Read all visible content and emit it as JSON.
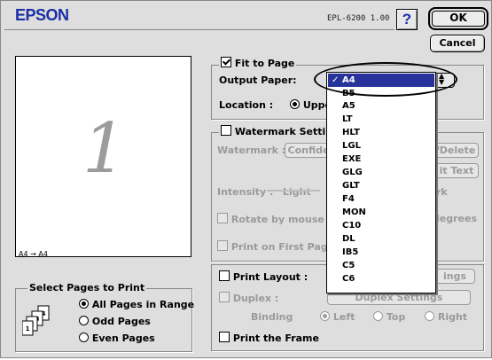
{
  "header": {
    "brand": "EPSON",
    "model_version": "EPL-6200  1.00",
    "help_label": "?",
    "ok_label": "OK",
    "cancel_label": "Cancel"
  },
  "preview": {
    "page_number": "1",
    "size_caption": "A4 → A4"
  },
  "select_pages": {
    "title": "Select Pages to Print",
    "options": [
      "All Pages in Range",
      "Odd Pages",
      "Even Pages"
    ],
    "selected": "All Pages in Range"
  },
  "fit_to_page": {
    "label": "Fit to Page",
    "checked": true,
    "output_paper_label": "Output Paper:",
    "location_label": "Location :",
    "location_value": "Uppe"
  },
  "paper_menu": {
    "selected": "A4",
    "items": [
      "A4",
      "B5",
      "A5",
      "LT",
      "HLT",
      "LGL",
      "EXE",
      "GLG",
      "GLT",
      "F4",
      "MON",
      "C10",
      "DL",
      "IB5",
      "C5",
      "C6"
    ]
  },
  "watermark": {
    "label": "Watermark Settin",
    "checked": false,
    "watermark_label": "Watermark :",
    "watermark_value": "Confide",
    "add_delete_label": "/Delete",
    "edit_text_label": "it Text",
    "intensity_label": "Intensity :",
    "intensity_light": "Light",
    "intensity_dark": "rk",
    "rotate_label": "Rotate by mouse",
    "rotate_unit": "legrees",
    "first_page_label": "Print on First Page"
  },
  "layout": {
    "print_layout_label": "Print Layout :",
    "print_layout_checked": false,
    "layout_settings_label": "ings",
    "duplex_label": "Duplex :",
    "duplex_settings_label": "Duplex Settings",
    "binding_label": "Binding",
    "binding_options": [
      "Left",
      "Top",
      "Right"
    ],
    "binding_selected": "Left",
    "print_frame_label": "Print the Frame"
  }
}
